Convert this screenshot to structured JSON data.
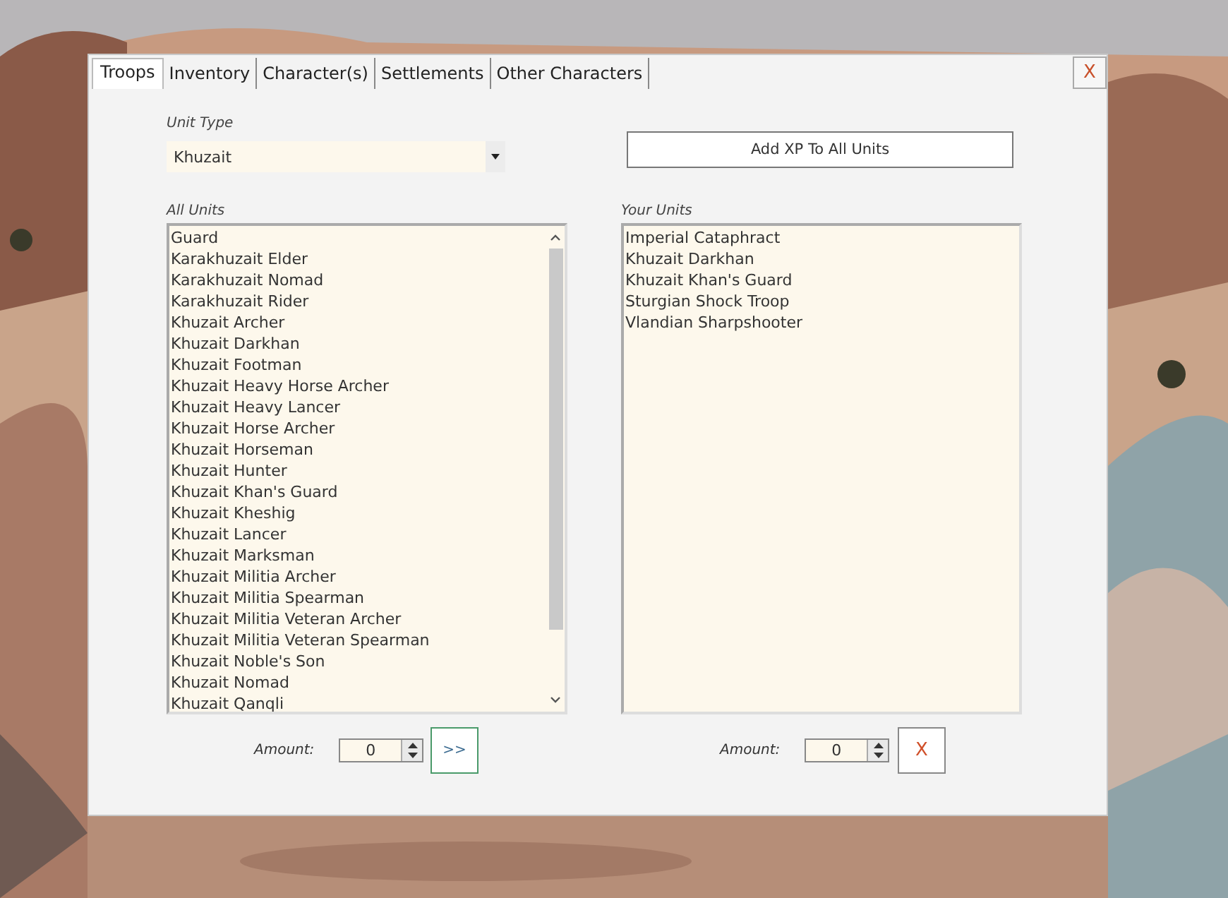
{
  "tabs": [
    {
      "label": "Troops",
      "selected": true
    },
    {
      "label": "Inventory",
      "selected": false
    },
    {
      "label": "Character(s)",
      "selected": false
    },
    {
      "label": "Settlements",
      "selected": false
    },
    {
      "label": "Other Characters",
      "selected": false
    }
  ],
  "close_button": "X",
  "unit_type": {
    "label": "Unit Type",
    "value": "Khuzait"
  },
  "add_xp_button": "Add XP To All Units",
  "all_units": {
    "label": "All Units",
    "items": [
      {
        "name": "Guard",
        "selected": false
      },
      {
        "name": "Karakhuzait Elder",
        "selected": false
      },
      {
        "name": "Karakhuzait Nomad",
        "selected": false
      },
      {
        "name": "Karakhuzait Rider",
        "selected": false
      },
      {
        "name": "Khuzait Archer",
        "selected": false
      },
      {
        "name": "Khuzait Darkhan",
        "selected": false
      },
      {
        "name": "Khuzait Footman",
        "selected": false
      },
      {
        "name": "Khuzait Heavy Horse Archer",
        "selected": false
      },
      {
        "name": "Khuzait Heavy Lancer",
        "selected": false
      },
      {
        "name": "Khuzait Horse Archer",
        "selected": false
      },
      {
        "name": "Khuzait Horseman",
        "selected": false
      },
      {
        "name": "Khuzait Hunter",
        "selected": false
      },
      {
        "name": "Khuzait Khan's Guard",
        "selected": false
      },
      {
        "name": "Khuzait Kheshig",
        "selected": false
      },
      {
        "name": "Khuzait Lancer",
        "selected": false
      },
      {
        "name": "Khuzait Marksman",
        "selected": false
      },
      {
        "name": "Khuzait Militia Archer",
        "selected": false
      },
      {
        "name": "Khuzait Militia Spearman",
        "selected": false
      },
      {
        "name": "Khuzait Militia Veteran Archer",
        "selected": false
      },
      {
        "name": "Khuzait Militia Veteran Spearman",
        "selected": false
      },
      {
        "name": "Khuzait Noble's Son",
        "selected": false
      },
      {
        "name": "Khuzait Nomad",
        "selected": false
      },
      {
        "name": "Khuzait Qanqli",
        "selected": false
      }
    ]
  },
  "your_units": {
    "label": "Your Units",
    "items": [
      {
        "name": "Imperial Cataphract",
        "selected": false
      },
      {
        "name": "Khuzait Darkhan",
        "selected": false
      },
      {
        "name": "Khuzait Khan's Guard",
        "selected": false
      },
      {
        "name": "Sturgian Shock Troop",
        "selected": false
      },
      {
        "name": "Vlandian Sharpshooter",
        "selected": false
      }
    ]
  },
  "left_amount": {
    "label": "Amount:",
    "value": "0",
    "button": ">>"
  },
  "right_amount": {
    "label": "Amount:",
    "value": "0",
    "button": "X"
  }
}
